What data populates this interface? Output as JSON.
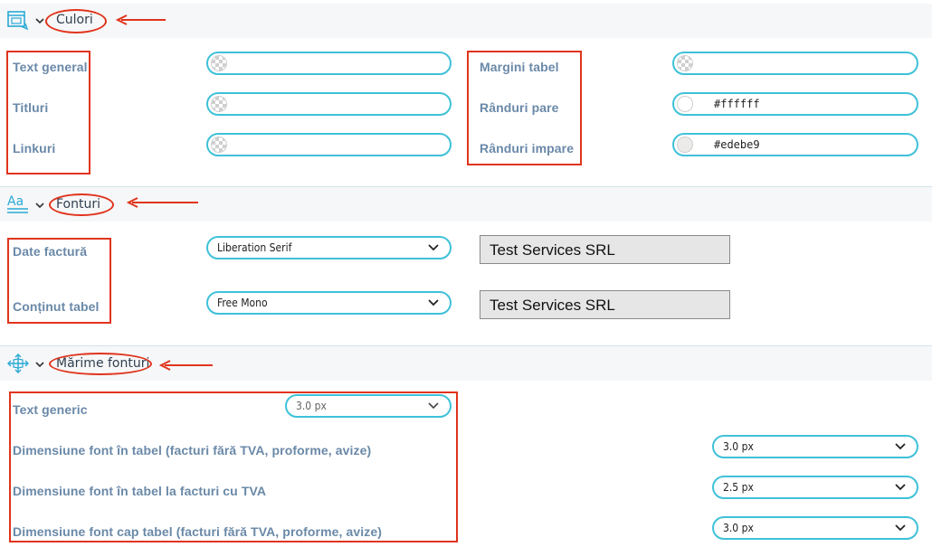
{
  "colors": {
    "accent": "#3fc1d9",
    "annotation_red": "#e0341d",
    "label": "#6a89a8"
  },
  "sections": {
    "culori": {
      "title": "Culori",
      "icon": "window-icon",
      "left_items": [
        {
          "label": "Text general",
          "value": ""
        },
        {
          "label": "Titluri",
          "value": ""
        },
        {
          "label": "Linkuri",
          "value": ""
        }
      ],
      "right_items": [
        {
          "label": "Margini tabel",
          "value": ""
        },
        {
          "label": "Rânduri pare",
          "value": "#ffffff",
          "swatch": "#ffffff"
        },
        {
          "label": "Rânduri impare",
          "value": "#edebe9",
          "swatch": "#edebe9"
        }
      ]
    },
    "fonturi": {
      "title": "Fonturi",
      "icon": "font-icon",
      "items": [
        {
          "label": "Date factură",
          "selected": "Liberation Serif",
          "preview": "Test Services SRL"
        },
        {
          "label": "Conținut tabel",
          "selected": "Free Mono",
          "preview": "Test Services SRL"
        }
      ]
    },
    "marime": {
      "title": "Mărime fonturi",
      "icon": "move-arrows-icon",
      "items": [
        {
          "label": "Text generic",
          "selected": "3.0 px"
        },
        {
          "label": "Dimensiune font în tabel (facturi fără TVA, proforme, avize)",
          "selected": "3.0 px"
        },
        {
          "label": "Dimensiune font în tabel la facturi cu TVA",
          "selected": "2.5 px"
        },
        {
          "label": "Dimensiune font cap tabel (facturi fără TVA, proforme, avize)",
          "selected": "3.0 px"
        }
      ]
    }
  }
}
